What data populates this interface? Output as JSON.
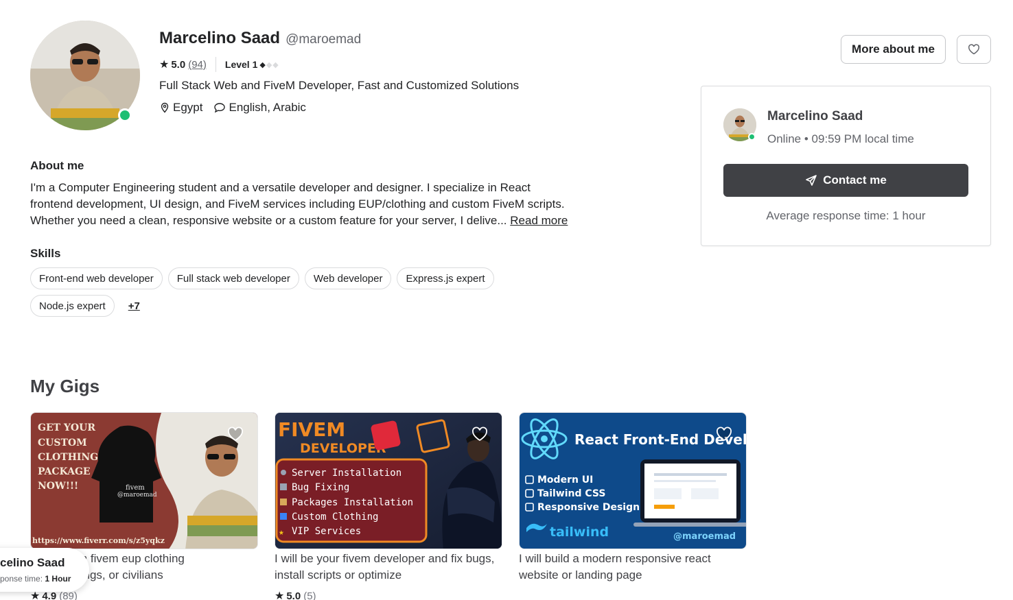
{
  "profile": {
    "name": "Marcelino Saad",
    "handle": "@maroemad",
    "rating": "5.0",
    "reviews": "(94)",
    "level": "Level 1",
    "level_filled": 1,
    "level_total": 3,
    "tagline": "Full Stack Web and FiveM Developer, Fast and Customized Solutions",
    "location": "Egypt",
    "languages": "English, Arabic",
    "online": true
  },
  "header_actions": {
    "more_label": "More about me",
    "fav_icon": "heart-icon"
  },
  "contact_card": {
    "name": "Marcelino Saad",
    "status": "Online • 09:59 PM local time",
    "button_label": "Contact me",
    "response": "Average response time: 1 hour"
  },
  "about": {
    "title": "About me",
    "line1": "I'm a Computer Engineering student and a versatile developer and designer. I specialize in React",
    "line2": "frontend development, UI design, and FiveM services including EUP/clothing and custom FiveM scripts.",
    "line3": "Whether you need a clean, responsive website or a custom feature for your server, I delive...",
    "read_more": "Read more"
  },
  "skills": {
    "title": "Skills",
    "items": [
      "Front-end web developer",
      "Full stack web developer",
      "Web developer",
      "Express.js expert",
      "Node.js expert"
    ],
    "more": "+7"
  },
  "gigs": {
    "title": "My Gigs",
    "items": [
      {
        "title_l1": "...e custom fivem eup clothing",
        "title_l2": "...olice, gangs, or civilians",
        "rating": "4.9",
        "count": "(89)",
        "image_text": [
          "GET YOUR",
          "CUSTOM",
          "CLOTHING",
          "PACKAGE",
          "NOW!!!",
          "https://www.fiverr.com/s/z5yqkz",
          "fivem",
          "@maroemad"
        ]
      },
      {
        "title_l1": "I will be your fivem developer and fix bugs,",
        "title_l2": "install scripts or optimize",
        "rating": "5.0",
        "count": "(5)",
        "image_text": [
          "FIVEM",
          "DEVELOPER",
          "Server Installation",
          "Bug Fixing",
          "Packages Installation",
          "Custom Clothing",
          "VIP Services"
        ]
      },
      {
        "title_l1": "I will build a modern responsive react",
        "title_l2": "website or landing page",
        "image_text": [
          "React Front-End Develope",
          "Modern UI",
          "Tailwind CSS",
          "Responsive Design",
          "tailwind",
          "@maroemad"
        ]
      }
    ]
  },
  "mini_card": {
    "name": "celino Saad",
    "resp_label": "ponse time:",
    "resp_value": "1 Hour"
  },
  "colors": {
    "online": "#1dbf73",
    "dark_button": "#404145",
    "gig1_bg": "#8b3a32",
    "gig2_bg": "#1f2a44",
    "gig3_bg": "#0e4a8a"
  }
}
